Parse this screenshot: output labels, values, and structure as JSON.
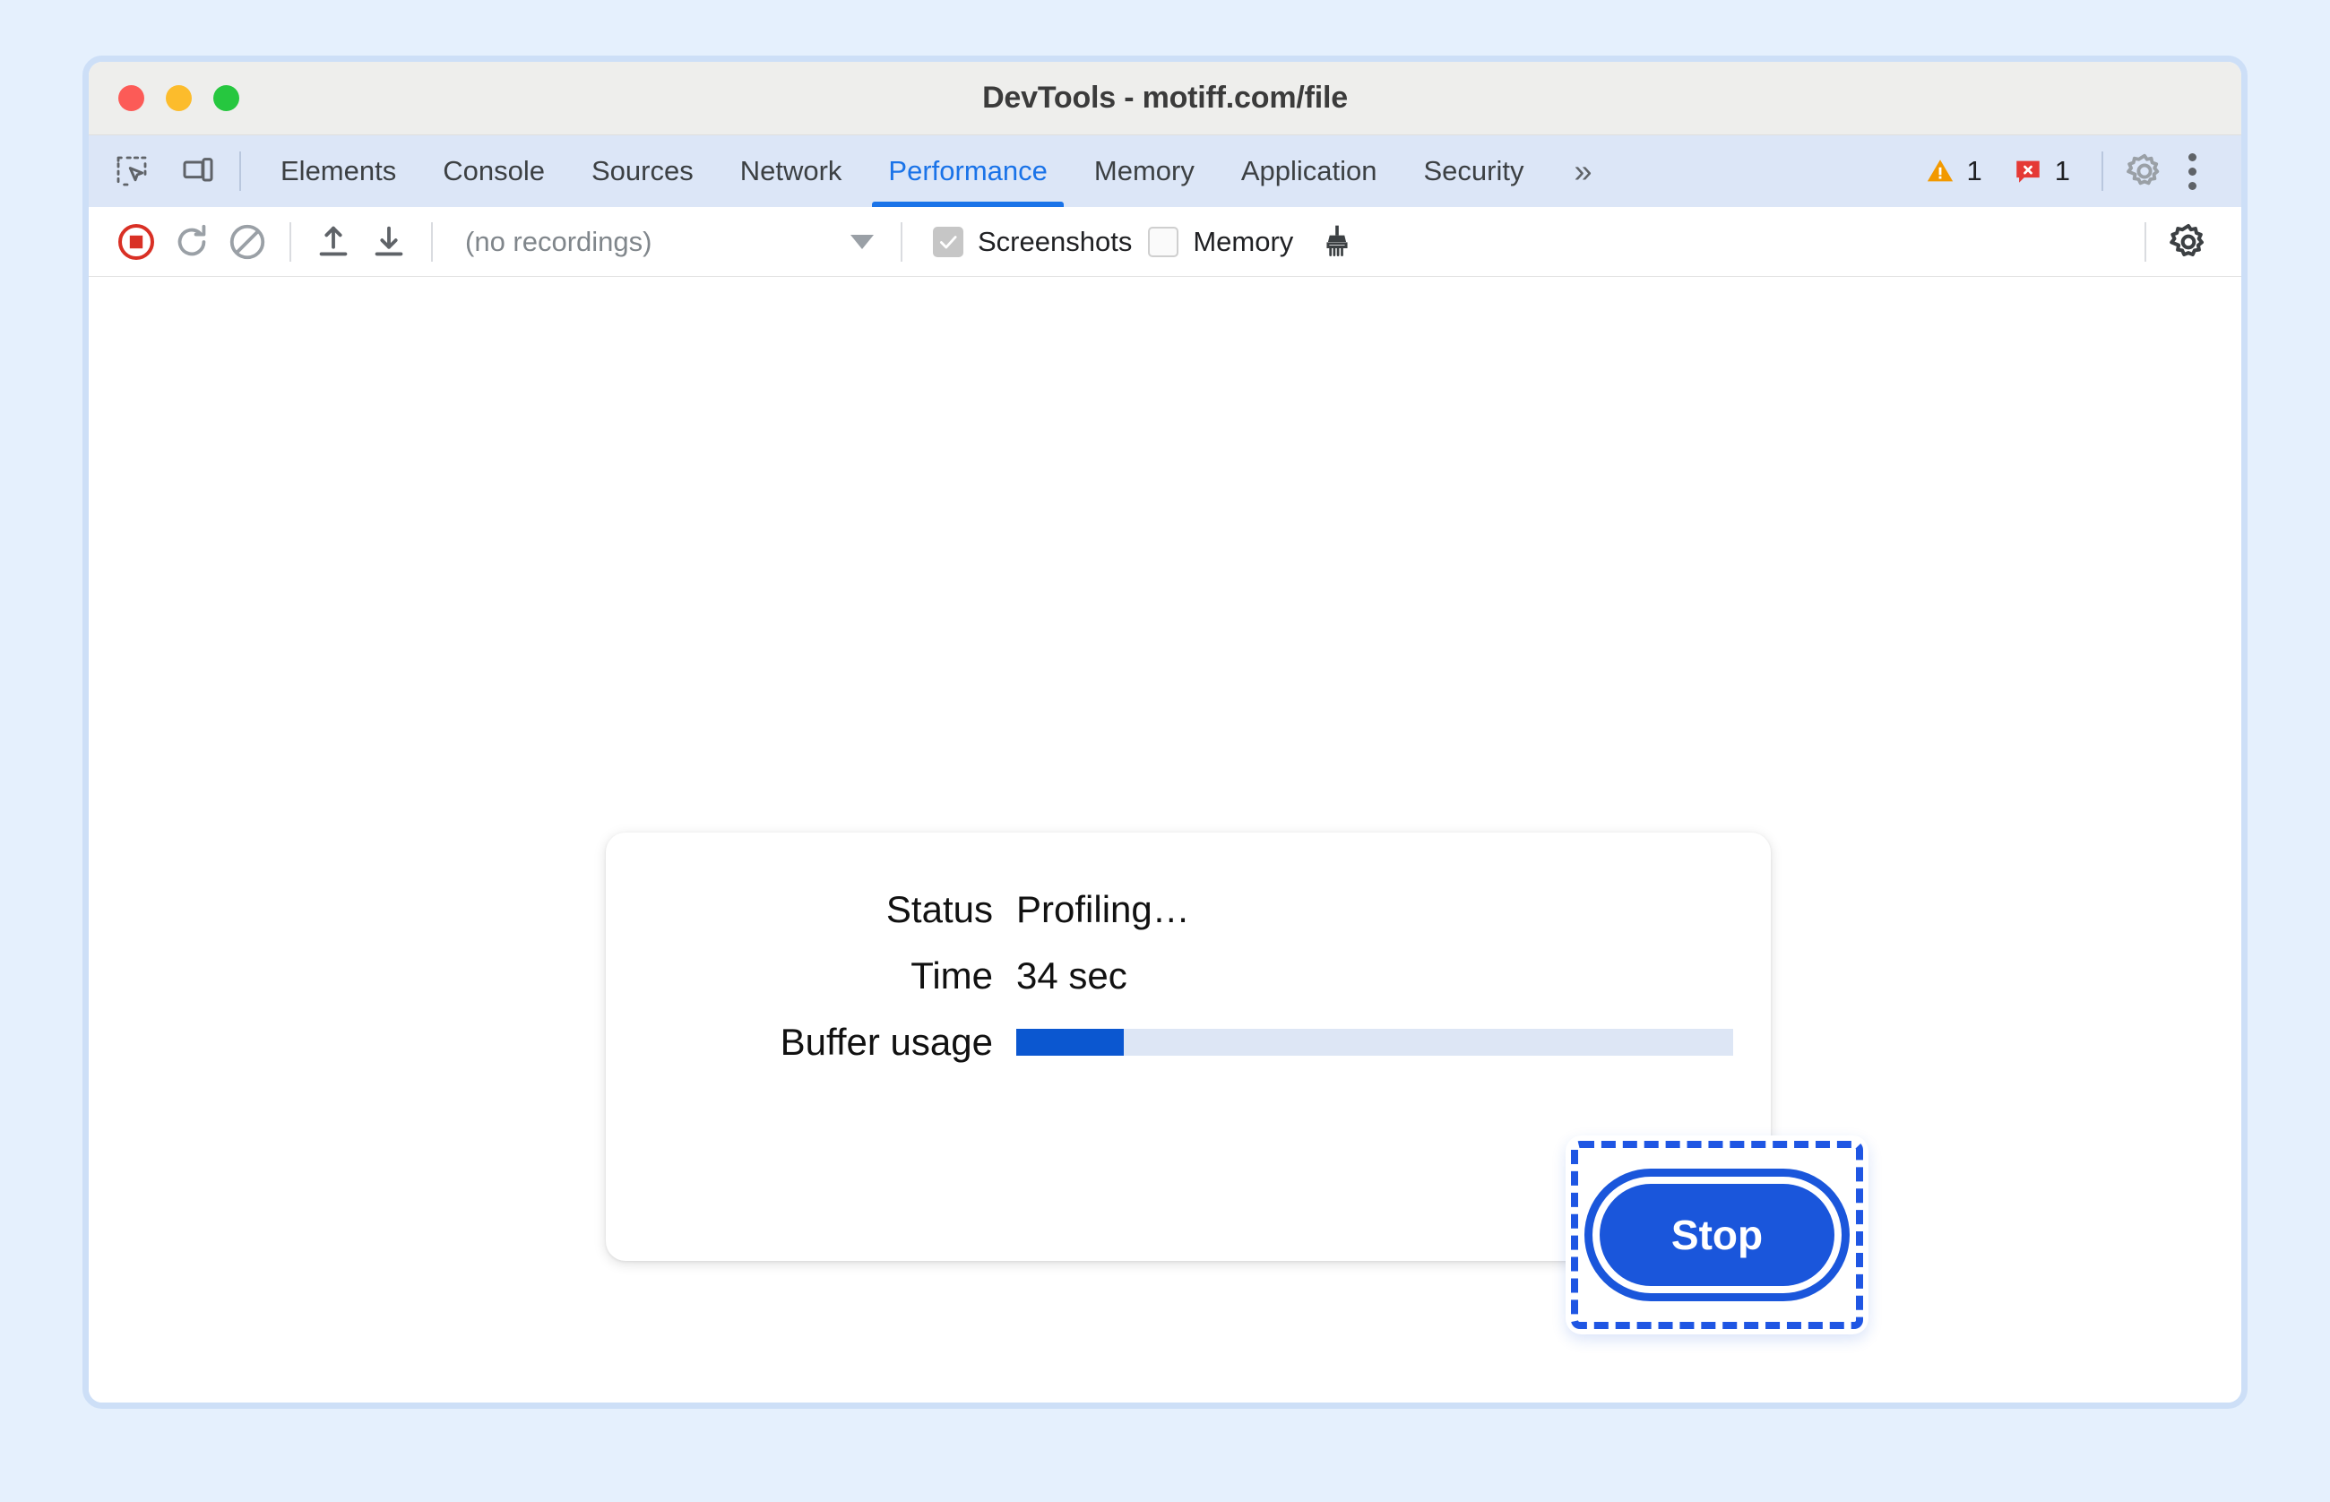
{
  "window": {
    "title": "DevTools - motiff.com/file",
    "traffic_lights": [
      "close-red",
      "minimize-yellow",
      "maximize-green"
    ]
  },
  "tabbar": {
    "icons": [
      {
        "name": "inspect-element-icon"
      },
      {
        "name": "device-toolbar-icon"
      }
    ],
    "tabs": [
      {
        "label": "Elements",
        "active": false
      },
      {
        "label": "Console",
        "active": false
      },
      {
        "label": "Sources",
        "active": false
      },
      {
        "label": "Network",
        "active": false
      },
      {
        "label": "Performance",
        "active": true
      },
      {
        "label": "Memory",
        "active": false
      },
      {
        "label": "Application",
        "active": false
      },
      {
        "label": "Security",
        "active": false
      }
    ],
    "more_tabs_label": "»",
    "warning_count": "1",
    "error_count": "1",
    "settings_icon": "gear-icon",
    "menu_icon": "kebab-menu-icon",
    "colors": {
      "active_tab": "#1a73e8",
      "warning": "#f29900",
      "error": "#e53935",
      "tabbar_bg": "#dce6f7"
    }
  },
  "toolbar": {
    "record_button": {
      "name": "record-button",
      "state": "recording",
      "color": "#d93025"
    },
    "reload_button": {
      "name": "reload-and-record-button"
    },
    "clear_button": {
      "name": "clear-recording-button"
    },
    "load_button": {
      "name": "load-profile-button"
    },
    "save_button": {
      "name": "save-profile-button"
    },
    "recordings_select": {
      "value": "(no recordings)"
    },
    "screenshots": {
      "label": "Screenshots",
      "checked": true
    },
    "memory": {
      "label": "Memory",
      "checked": false
    },
    "cleanup_icon": "collect-garbage-icon",
    "settings_icon": "capture-settings-gear-icon"
  },
  "status_card": {
    "rows": [
      {
        "label": "Status",
        "value": "Profiling…"
      },
      {
        "label": "Time",
        "value": "34 sec"
      }
    ],
    "buffer": {
      "label": "Buffer usage",
      "percent": 15,
      "fill_color": "#0b57d0",
      "track_color": "#dde6f5"
    },
    "stop_button": {
      "label": "Stop",
      "color": "#1a56db",
      "highlighted": true,
      "highlight_color": "#1f56e3"
    }
  }
}
